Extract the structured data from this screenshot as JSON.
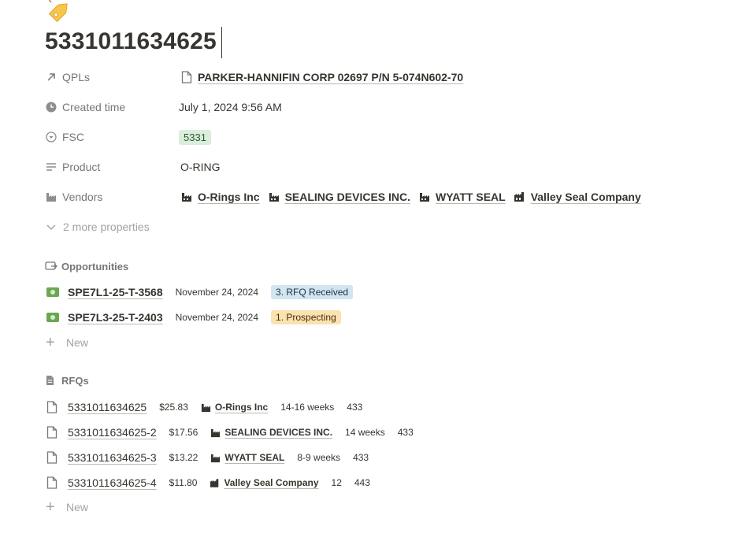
{
  "page": {
    "icon": "tag-icon",
    "title": "5331011634625"
  },
  "properties": [
    {
      "key": "QPLs",
      "icon": "arrow-up-right-icon",
      "value": "PARKER-HANNIFIN CORP 02697 P/N 5-074N602-70",
      "value_icon": "document-icon"
    },
    {
      "key": "Created time",
      "icon": "clock-icon",
      "value": "July 1, 2024 9:56 AM"
    },
    {
      "key": "FSC",
      "icon": "select-icon",
      "value": "5331"
    },
    {
      "key": "Product",
      "icon": "text-lines-icon",
      "value": "O-RING"
    },
    {
      "key": "Vendors",
      "icon": "factory-icon",
      "vendors": [
        "O-Rings Inc",
        "SEALING DEVICES INC.",
        "WYATT SEAL",
        "Valley Seal Company"
      ]
    }
  ],
  "more_properties": "2 more properties",
  "opportunities": {
    "heading": "Opportunities",
    "rows": [
      {
        "id": "SPE7L1-25-T-3568",
        "date": "November 24, 2024",
        "status": "3. RFQ Received"
      },
      {
        "id": "SPE7L3-25-T-2403",
        "date": "November 24, 2024",
        "status": "1. Prospecting"
      }
    ],
    "new_label": "New"
  },
  "rfqs": {
    "heading": "RFQs",
    "rows": [
      {
        "id": "5331011634625",
        "price": "$25.83",
        "vendor": "O-Rings Inc",
        "lead": "14-16 weeks",
        "qty": "433"
      },
      {
        "id": "5331011634625-2",
        "price": "$17.56",
        "vendor": "SEALING DEVICES INC.",
        "lead": "14 weeks",
        "qty": "433"
      },
      {
        "id": "5331011634625-3",
        "price": "$13.22",
        "vendor": "WYATT SEAL",
        "lead": "8-9 weeks",
        "qty": "433"
      },
      {
        "id": "5331011634625-4",
        "price": "$11.80",
        "vendor": "Valley Seal Company",
        "lead": "12",
        "qty": "443"
      }
    ],
    "new_label": "New"
  },
  "colors": {
    "fsc_tag_bg": "#dbeddb",
    "status_blue_bg": "#d3e5ef",
    "status_orange_bg": "#fbe3b0",
    "text": "#37352f",
    "muted": "#787774"
  }
}
